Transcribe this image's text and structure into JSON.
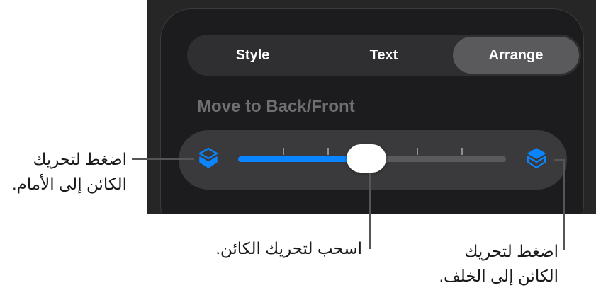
{
  "segmented_control": {
    "tabs": [
      {
        "label": "Style",
        "selected": false
      },
      {
        "label": "Text",
        "selected": false
      },
      {
        "label": "Arrange",
        "selected": true
      }
    ]
  },
  "arrange": {
    "section_label": "Move to Back/Front",
    "slider": {
      "value": 0.48,
      "tick_count": 6,
      "accent_color": "#0a84ff",
      "left_icon": "layers-send-backward-icon",
      "right_icon": "layers-bring-forward-icon"
    }
  },
  "callouts": {
    "left_line1": "اضغط لتحريك",
    "left_line2": "الكائن إلى الأمام.",
    "center": "اسحب لتحريك الكائن.",
    "right_line1": "اضغط لتحريك",
    "right_line2": "الكائن إلى الخلف."
  }
}
